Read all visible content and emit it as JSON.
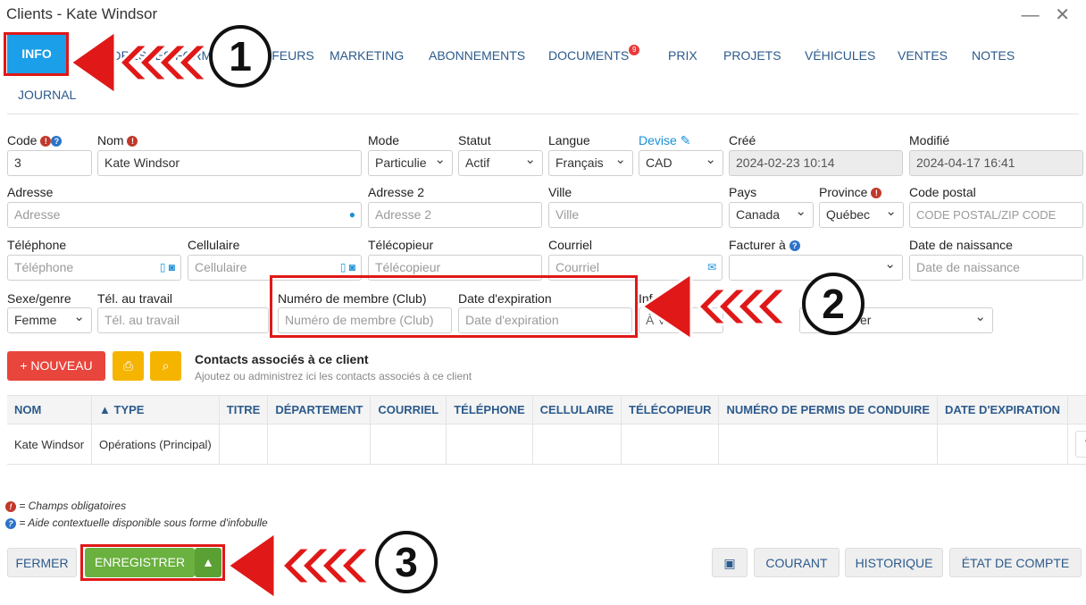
{
  "window": {
    "title": "Clients - Kate Windsor",
    "controls": "— ✕"
  },
  "tabs": [
    {
      "label": "INFO"
    },
    {
      "label": "ADRESSES"
    },
    {
      "label": "FORMES"
    },
    {
      "label": "CHAUFFEURS"
    },
    {
      "label": "MARKETING"
    },
    {
      "label": "ABONNEMENTS"
    },
    {
      "label": "DOCUMENTS",
      "badge": "9"
    },
    {
      "label": "PRIX"
    },
    {
      "label": "PROJETS"
    },
    {
      "label": "VÉHICULES"
    },
    {
      "label": "VENTES"
    },
    {
      "label": "NOTES"
    },
    {
      "label": "JOURNAL"
    }
  ],
  "form": {
    "code": {
      "label": "Code",
      "value": "3"
    },
    "nom": {
      "label": "Nom",
      "value": "Kate Windsor"
    },
    "mode": {
      "label": "Mode",
      "value": "Particulie"
    },
    "statut": {
      "label": "Statut",
      "value": "Actif"
    },
    "langue": {
      "label": "Langue",
      "value": "Français"
    },
    "devise": {
      "label": "Devise",
      "value": "CAD"
    },
    "cree": {
      "label": "Créé",
      "value": "2024-02-23 10:14"
    },
    "modifie": {
      "label": "Modifié",
      "value": "2024-04-17 16:41"
    },
    "adresse": {
      "label": "Adresse",
      "placeholder": "Adresse"
    },
    "adresse2": {
      "label": "Adresse 2",
      "placeholder": "Adresse 2"
    },
    "ville": {
      "label": "Ville",
      "placeholder": "Ville"
    },
    "pays": {
      "label": "Pays",
      "value": "Canada"
    },
    "province": {
      "label": "Province",
      "value": "Québec"
    },
    "code_postal": {
      "label": "Code postal",
      "placeholder": "CODE POSTAL/ZIP CODE"
    },
    "telephone": {
      "label": "Téléphone",
      "placeholder": "Téléphone"
    },
    "cellulaire": {
      "label": "Cellulaire",
      "placeholder": "Cellulaire"
    },
    "telecopieur": {
      "label": "Télécopieur",
      "placeholder": "Télécopieur"
    },
    "courriel": {
      "label": "Courriel",
      "placeholder": "Courriel"
    },
    "facturer": {
      "label": "Facturer à",
      "value": ""
    },
    "naissance": {
      "label": "Date de naissance",
      "placeholder": "Date de naissance"
    },
    "sexe": {
      "label": "Sexe/genre",
      "value": "Femme"
    },
    "tel_travail": {
      "label": "Tél. au travail",
      "placeholder": "Tél. au travail"
    },
    "membre": {
      "label": "Numéro de membre (Club)",
      "placeholder": "Numéro de membre (Club)"
    },
    "expiration": {
      "label": "Date d'expiration",
      "placeholder": "Date d'expiration"
    },
    "info_partial": {
      "label": "Infol",
      "value": "À V"
    },
    "other_select": {
      "value": "er"
    }
  },
  "contacts": {
    "new_button": "+ NOUVEAU",
    "title": "Contacts associés à ce client",
    "subtitle": "Ajoutez ou administrez ici les contacts associés à ce client",
    "columns": [
      "NOM",
      "▲ TYPE",
      "TITRE",
      "DÉPARTEMENT",
      "COURRIEL",
      "TÉLÉPHONE",
      "CELLULAIRE",
      "TÉLÉCOPIEUR",
      "NUMÉRO DE PERMIS DE CONDUIRE",
      "DATE D'EXPIRATION",
      ""
    ],
    "rows": [
      [
        "Kate Windsor",
        "Opérations (Principal)",
        "",
        "",
        "",
        "",
        "",
        "",
        "",
        "",
        ""
      ]
    ]
  },
  "legend": {
    "required": "= Champs obligatoires",
    "help": "= Aide contextuelle disponible sous forme d'infobulle"
  },
  "footer": {
    "fermer": "FERMER",
    "enregistrer": "ENREGISTRER",
    "courant": "COURANT",
    "historique": "HISTORIQUE",
    "etat": "ÉTAT DE COMPTE"
  },
  "callouts": [
    "1",
    "2",
    "3"
  ],
  "colors": {
    "accent": "#1b9fe8",
    "highlight": "#e01818",
    "save": "#6ab13f",
    "danger": "#e8453c",
    "warning": "#f5b400"
  }
}
